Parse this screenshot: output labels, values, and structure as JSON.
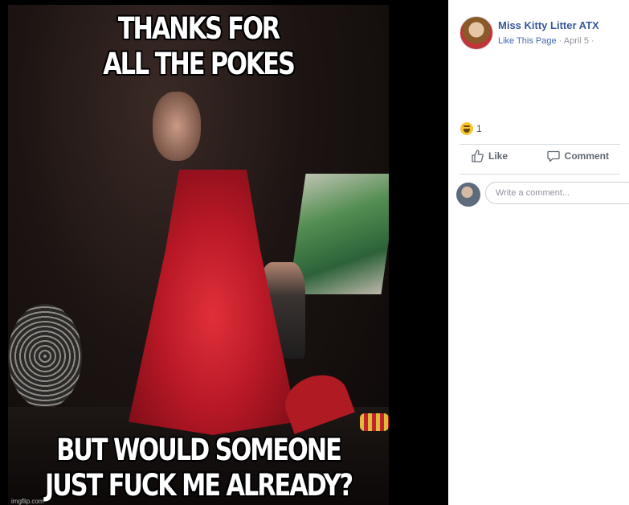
{
  "meme": {
    "top_line1": "THANKS FOR",
    "top_line2": "ALL THE POKES",
    "bottom_line1": "BUT WOULD SOMEONE",
    "bottom_line2": "JUST FUCK ME ALREADY?",
    "watermark": "imgflip.com"
  },
  "post": {
    "author": "Miss Kitty Litter ATX",
    "like_page": "Like This Page",
    "date": "· April 5 ·",
    "reaction_count": "1"
  },
  "actions": {
    "like_label": "Like",
    "comment_label": "Comment"
  },
  "comment_input": {
    "placeholder": "Write a comment..."
  },
  "colors": {
    "link": "#365899",
    "action": "#606770",
    "haha": "#f7c72d"
  }
}
